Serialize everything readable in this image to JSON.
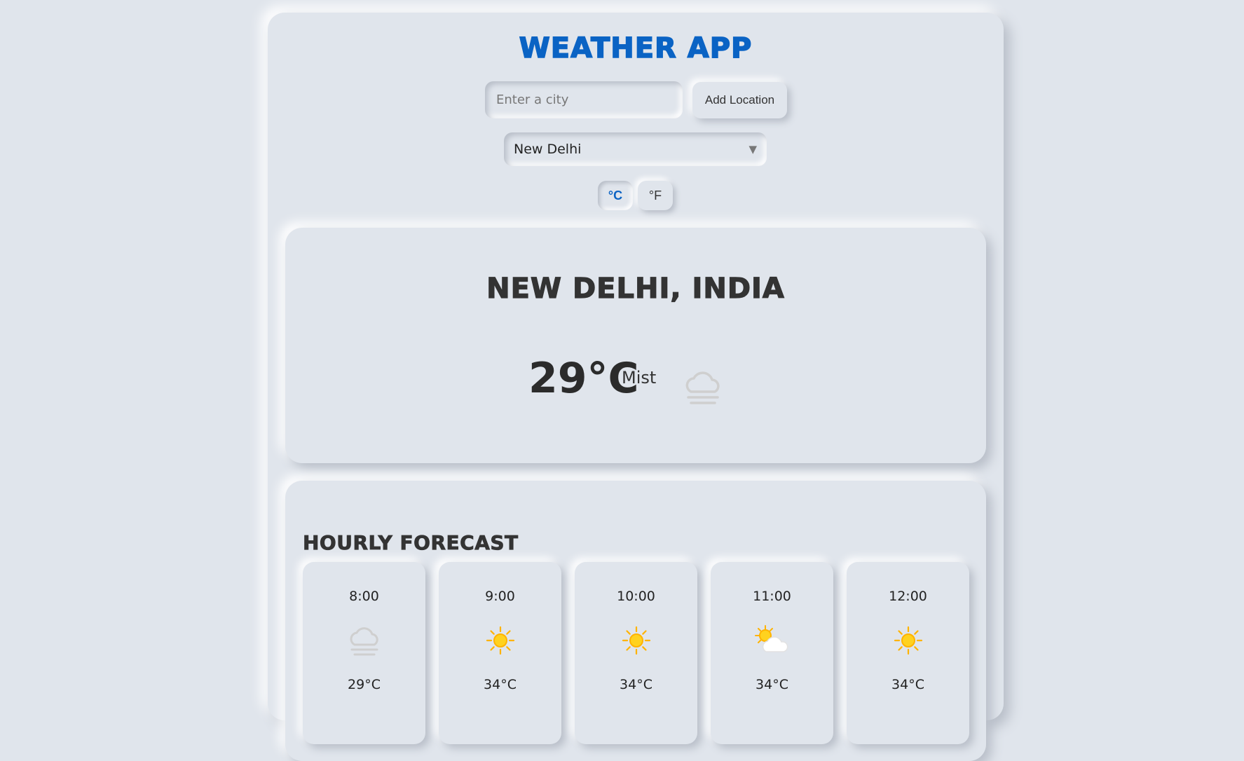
{
  "app": {
    "title": "Weather App"
  },
  "search": {
    "placeholder": "Enter a city",
    "value": "",
    "add_label": "Add Location"
  },
  "location_select": {
    "selected": "New Delhi"
  },
  "units": {
    "celsius_label": "°C",
    "fahrenheit_label": "°F",
    "active": "celsius"
  },
  "current": {
    "city": "New Delhi, India",
    "temp": "29°C",
    "condition": "Mist",
    "icon": "mist-icon"
  },
  "hourly": {
    "title": "Hourly Forecast",
    "items": [
      {
        "time": "8:00",
        "temp": "29°C",
        "icon": "mist-icon"
      },
      {
        "time": "9:00",
        "temp": "34°C",
        "icon": "sun-icon"
      },
      {
        "time": "10:00",
        "temp": "34°C",
        "icon": "sun-icon"
      },
      {
        "time": "11:00",
        "temp": "34°C",
        "icon": "partly-cloudy-icon"
      },
      {
        "time": "12:00",
        "temp": "34°C",
        "icon": "sun-icon"
      }
    ]
  },
  "colors": {
    "accent": "#0a63c4",
    "background": "#e0e5ec",
    "text": "#333333",
    "sun": "#ffc107"
  }
}
